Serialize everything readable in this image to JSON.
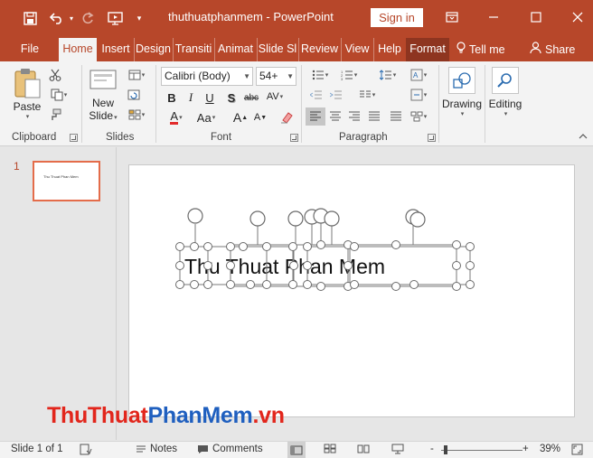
{
  "titlebar": {
    "title": "thuthuatphanmem  -  PowerPoint",
    "sign_in": "Sign in",
    "quick_access": [
      "save-icon",
      "undo-icon",
      "redo-icon",
      "present-from-start-icon",
      "customize-qat-icon"
    ]
  },
  "tabs": [
    {
      "label": "File"
    },
    {
      "label": "Home"
    },
    {
      "label": "Insert"
    },
    {
      "label": "Design"
    },
    {
      "label": "Transiti"
    },
    {
      "label": "Animat"
    },
    {
      "label": "Slide Sl"
    },
    {
      "label": "Review"
    },
    {
      "label": "View"
    },
    {
      "label": "Help"
    },
    {
      "label": "Format"
    },
    {
      "label": "Tell me"
    },
    {
      "label": "Share"
    }
  ],
  "ribbon": {
    "clipboard": {
      "label": "Clipboard",
      "paste": "Paste"
    },
    "slides": {
      "label": "Slides",
      "new_slide_line1": "New",
      "new_slide_line2": "Slide"
    },
    "font": {
      "label": "Font",
      "font_name": "Calibri (Body)",
      "font_size": "54+",
      "bold": "B",
      "italic": "I",
      "underline": "U",
      "shadow": "S",
      "strike": "abc",
      "spacing": "AV",
      "color": "A",
      "case": "Aa",
      "grow": "A",
      "shrink": "A"
    },
    "paragraph": {
      "label": "Paragraph"
    },
    "drawing": {
      "label": "Drawing"
    },
    "editing": {
      "label": "Editing"
    }
  },
  "slides_panel": {
    "number": "1",
    "thumb_text": "Thu Thuat Phan Mem"
  },
  "slide": {
    "text": "Thu Thuat Phan Mem"
  },
  "watermark": {
    "part1": "Thu",
    "part2": "Thuat",
    "part3": "Phan",
    "part4": "Mem",
    "part5": ".vn"
  },
  "statusbar": {
    "slide_info": "Slide 1 of 1",
    "notes": "Notes",
    "comments": "Comments",
    "zoom_minus": "-",
    "zoom_plus": "+",
    "zoom": "39%"
  },
  "colors": {
    "accent": "#b7472a",
    "watermark_red": "#e2261c",
    "watermark_blue": "#1f5fbf",
    "selection_handle": "#7a7a7a"
  }
}
